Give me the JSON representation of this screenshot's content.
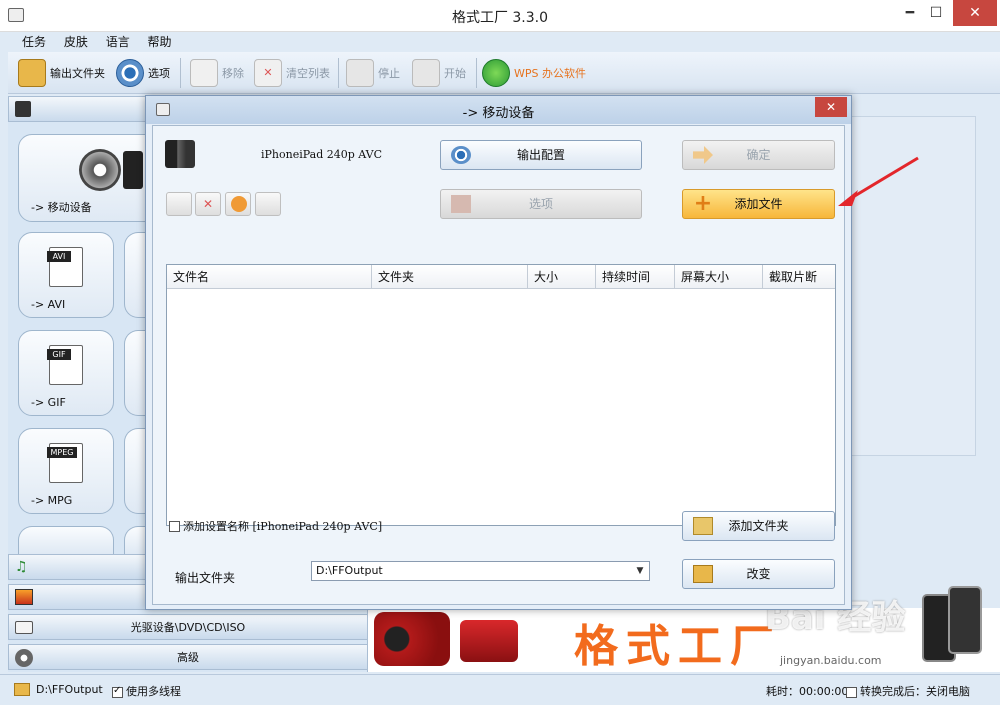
{
  "window": {
    "title": "格式工厂 3.3.0",
    "min_glyph": "━",
    "max_glyph": "☐",
    "close_glyph": "✕"
  },
  "menu": [
    "任务",
    "皮肤",
    "语言",
    "帮助"
  ],
  "toolbar": {
    "output_folder": "输出文件夹",
    "options": "选项",
    "remove": "移除",
    "clear_list": "清空列表",
    "stop": "停止",
    "start": "开始",
    "wps": "WPS 办公软件"
  },
  "left_panel": {
    "tiles": [
      {
        "label": "-> 移动设备"
      },
      {
        "label": "-> AVI",
        "tag": "AVI"
      },
      {
        "label": "-> GIF",
        "tag": "GIF"
      },
      {
        "label": "-> MPG",
        "tag": "MPEG"
      }
    ],
    "categories": {
      "optical": "光驱设备\\DVD\\CD\\ISO",
      "advanced": "高级"
    }
  },
  "banner": {
    "brand": "格式工厂"
  },
  "status": {
    "output_path": "D:\\FFOutput",
    "multithread": "使用多线程",
    "multithread_checked": true,
    "elapsed": "耗时：00:00:00",
    "after_done": "转换完成后：关闭电脑"
  },
  "dialog": {
    "title": "-> 移动设备",
    "close_glyph": "✕",
    "profile": "iPhoneiPad 240p AVC",
    "output_config": "输出配置",
    "ok": "确定",
    "options": "选项",
    "add_file": "添加文件",
    "columns": [
      "文件名",
      "文件夹",
      "大小",
      "持续时间",
      "屏幕大小",
      "截取片断"
    ],
    "add_setting_name": "添加设置名称 [iPhoneiPad 240p AVC]",
    "add_setting_checked": false,
    "add_folder": "添加文件夹",
    "output_folder_label": "输出文件夹",
    "output_folder_value": "D:\\FFOutput",
    "change": "改变"
  },
  "watermark": {
    "text": "Bai 经验",
    "url": "jingyan.baidu.com"
  },
  "colors": {
    "accent_orange": "#f26b1d",
    "close_red": "#c7473f",
    "arrow_red": "#e3262b"
  }
}
